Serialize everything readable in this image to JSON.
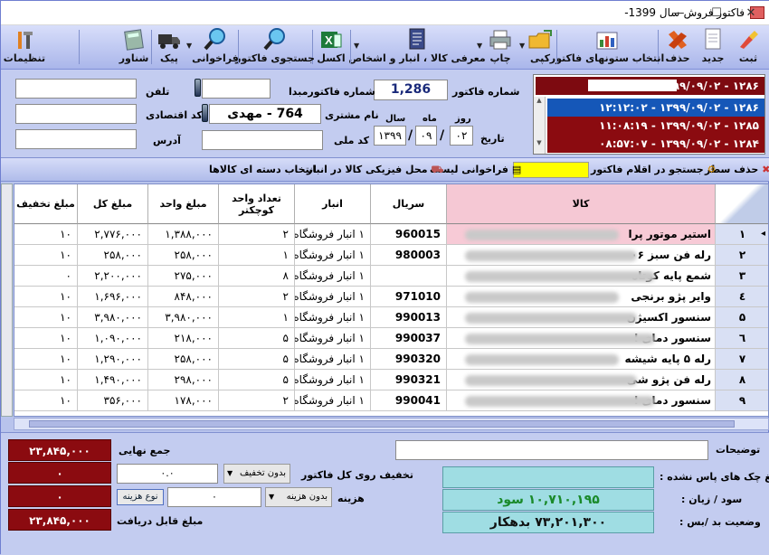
{
  "window": {
    "title": "فاکتور فروش-سال 1399-",
    "min": "—",
    "max": "☐",
    "close": "✕"
  },
  "toolbar": {
    "items": [
      {
        "label": "ثبت",
        "icon": "brush-icon"
      },
      {
        "label": "جدید",
        "icon": "new-document-icon"
      },
      {
        "label": "حذف",
        "icon": "delete-icon"
      },
      {
        "label": "انتخاب ستونهای فاکتور",
        "icon": "columns-chart-icon"
      },
      {
        "label": "کپی",
        "icon": "folder-icon"
      },
      {
        "label": "چاپ",
        "icon": "printer-icon"
      },
      {
        "label": "معرفی کالا ، انبار و اشخاص",
        "icon": "document-list-icon"
      },
      {
        "label": "اکسل",
        "icon": "excel-icon"
      },
      {
        "label": "جستجوی فاکتور",
        "icon": "search-icon"
      },
      {
        "label": "فراخوانی",
        "icon": "magnifier-icon"
      },
      {
        "label": "پیک",
        "icon": "truck-icon"
      },
      {
        "label": "شناور",
        "icon": "calculator-icon"
      },
      {
        "label": "تنظیمات",
        "icon": "tools-icon"
      }
    ]
  },
  "header": {
    "invoice_no_label": "شماره فاکتور",
    "invoice_no": "1,286",
    "date_label": "تاریخ",
    "day_label": "روز",
    "month_label": "ماه",
    "year_label": "سال",
    "day": "۰۲",
    "month": "۰۹",
    "year": "۱۳۹۹",
    "date_sep": "/",
    "source_no_label": "شماره فاکتورمبدا",
    "customer_label": "نام مشتری",
    "customer_value": "764  -  مهدی",
    "national_code_label": "کد ملی",
    "phone_label": "تلفن",
    "economic_code_label": "کد اقتصادی",
    "address_label": "آدرس"
  },
  "invoice_list": [
    {
      "text": "۱۲۸۶ - ۱۳۹۹/۰۹/۰۲ - ۱۲:۱۲:۰۲",
      "color": "#7d0a10"
    },
    {
      "text": "۱۲۸۶ - ۱۳۹۹/۰۹/۰۲ - ۱۲:۱۲:۰۲",
      "color": "#1557b8"
    },
    {
      "text": "۱۲۸۵ - ۱۳۹۹/۰۹/۰۲ - ۱۱:۰۸:۱۹",
      "color": "#8b0b10"
    },
    {
      "text": "۱۲۸۴ - ۱۳۹۹/۰۹/۰۲ - ۰۸:۵۷:۰۷",
      "color": "#8b0b10"
    }
  ],
  "actions": {
    "delete_row": "حذف سطر",
    "search_items": "جستجو در اقلام فاکتور",
    "load_list": "فراخوانی لیست",
    "physical_location": "محل فیزیکی کالا در انبار",
    "select_group": "انتخاب دسته ای کالاها"
  },
  "grid": {
    "columns": {
      "kala": "کالا",
      "serial": "سریال",
      "anbar": "انبار",
      "qty": "تعداد واحد کوچکتر",
      "unit_price": "مبلغ واحد",
      "total": "مبلغ کل",
      "discount": "مبلغ تخفیف"
    },
    "rows": [
      {
        "n": "۱",
        "kala": "استیر موتور پرا",
        "serial": "960015",
        "anbar": "۱ انبار فروشگاه",
        "qty": "۲",
        "unit": "۱,۳۸۸,۰۰۰",
        "total": "۲,۷۷۶,۰۰۰",
        "disc": "۱۰"
      },
      {
        "n": "۲",
        "kala": "رله فن سبز ۰۶",
        "serial": "980003",
        "anbar": "۱ انبار فروشگاه",
        "qty": "۱",
        "unit": "۲۵۸,۰۰۰",
        "total": "۲۵۸,۰۰۰",
        "disc": "۱۰"
      },
      {
        "n": "۳",
        "kala": "شمع پایه کوتاه",
        "serial": "",
        "anbar": "۱ انبار فروشگاه",
        "qty": "۸",
        "unit": "۲۷۵,۰۰۰",
        "total": "۲,۲۰۰,۰۰۰",
        "disc": "۰"
      },
      {
        "n": "٤",
        "kala": "وایر پژو برنجی",
        "serial": "971010",
        "anbar": "۱ انبار فروشگاه",
        "qty": "۲",
        "unit": "۸۴۸,۰۰۰",
        "total": "۱,۶۹۶,۰۰۰",
        "disc": "۱۰"
      },
      {
        "n": "۵",
        "kala": "سنسور اکسیژن",
        "serial": "990013",
        "anbar": "۱ انبار فروشگاه",
        "qty": "۱",
        "unit": "۳,۹۸۰,۰۰۰",
        "total": "۳,۹۸۰,۰۰۰",
        "disc": "۱۰"
      },
      {
        "n": "٦",
        "kala": "سنسور دمای ا",
        "serial": "990037",
        "anbar": "۱ انبار فروشگاه",
        "qty": "۵",
        "unit": "۲۱۸,۰۰۰",
        "total": "۱,۰۹۰,۰۰۰",
        "disc": "۱۰"
      },
      {
        "n": "۷",
        "kala": "رله ۵ پایه شیشه",
        "serial": "990320",
        "anbar": "۱ انبار فروشگاه",
        "qty": "۵",
        "unit": "۲۵۸,۰۰۰",
        "total": "۱,۲۹۰,۰۰۰",
        "disc": "۱۰"
      },
      {
        "n": "۸",
        "kala": "رله فن پژو شی",
        "serial": "990321",
        "anbar": "۱ انبار فروشگاه",
        "qty": "۵",
        "unit": "۲۹۸,۰۰۰",
        "total": "۱,۴۹۰,۰۰۰",
        "disc": "۱۰"
      },
      {
        "n": "۹",
        "kala": "سنسور دمای ا",
        "serial": "990041",
        "anbar": "۱ انبار فروشگاه",
        "qty": "۲",
        "unit": "۱۷۸,۰۰۰",
        "total": "۳۵۶,۰۰۰",
        "disc": "۱۰"
      }
    ]
  },
  "footer": {
    "final_total_label": "جمع نهایی",
    "final_total": "۲۳,۸۴۵,۰۰۰",
    "discount_total": "۰",
    "cost_total": "۰",
    "receivable_label": "مبلغ قابل دریافت",
    "receivable": "۲۳,۸۴۵,۰۰۰",
    "discount_on_invoice_label": "تخفیف  روی کل فاکتور",
    "discount_type": "بدون تخفیف",
    "discount_value": "۰.۰",
    "cost_label": "هزینه",
    "cost_type": "بدون هزینه",
    "cost_value": "۰",
    "cost_type_button": "نوع هزینه",
    "notes_label": "توضیحات",
    "unpaid_cheques_label": "مبلغ چک های پاس نشده :",
    "profit_label": "سود / زیان :",
    "profit_value": "۱۰,۷۱۰,۱۹۵   سود",
    "balance_label": "وضعیت بد /بس :",
    "balance_value": "۷۳,۲۰۱,۳۰۰   بدهکار"
  }
}
